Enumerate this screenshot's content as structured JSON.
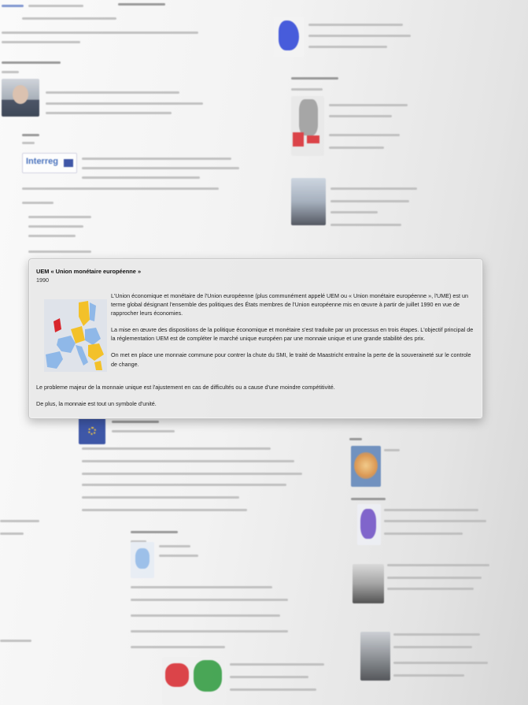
{
  "card": {
    "title": "UEM « Union monétaire européenne »",
    "year": "1990",
    "map_icon": "europe-map-icon",
    "paragraphs": [
      "L'Union économique et monétaire de l'Union européenne (plus communément appelé UEM ou « Union monétaire européenne », l'UME) est un terme global désignant l'ensemble des politiques des États membres de l'Union européenne mis en œuvre à partir de juillet 1990 en vue de rapprocher leurs économies.",
      "La mise en œuvre des dispositions de la politique économique et monétaire s'est traduite par un processus en trois étapes. L'objectif principal de la réglementation UEM est de compléter le marché unique européen par une monnaie unique et une grande stabilité des prix.",
      "On met en place une monnaie commune pour contrer la chute du SMI, le traité de Maastricht entraîne la perte de la souveraineté sur le controle de change."
    ],
    "footer_paragraphs": [
      "Le probleme majeur de la monnaie unique est l'ajustement en cas de difficultés ou a cause d'une moindre compétitivité.",
      "De plus, la monnaie est tout un symbole d'unité."
    ]
  },
  "background": {
    "interreg_logo": "Interreg",
    "colors": {
      "eu_blue": "#1f3c9a",
      "map_yellow": "#f3c12a",
      "map_red": "#d8262c",
      "map_light_blue": "#8fb8e8",
      "map_green": "#2c9a3c"
    }
  }
}
